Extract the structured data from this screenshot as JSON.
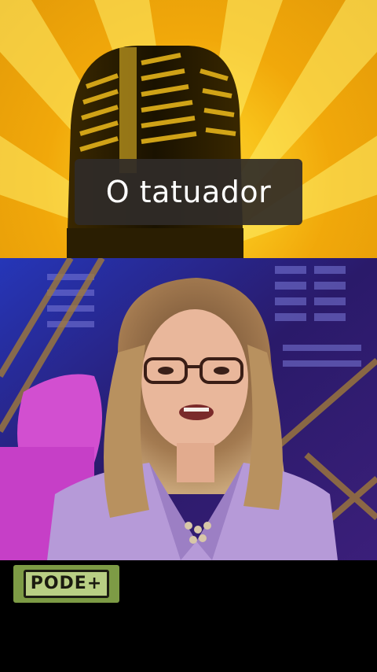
{
  "caption": {
    "text": "O tatuador"
  },
  "logo": {
    "text": "PODE+"
  },
  "colors": {
    "sun_background": "#f8c21a",
    "ray_light": "#ffe97a",
    "caption_background": "#302b28",
    "caption_text": "#ffffff",
    "studio_blue": "#2a1a6a",
    "blazer_lilac": "#b69ad8",
    "pink_prop": "#d24fd0",
    "logo_green": "#7d9b45"
  },
  "icons": {
    "microphone": "microphone-icon"
  }
}
